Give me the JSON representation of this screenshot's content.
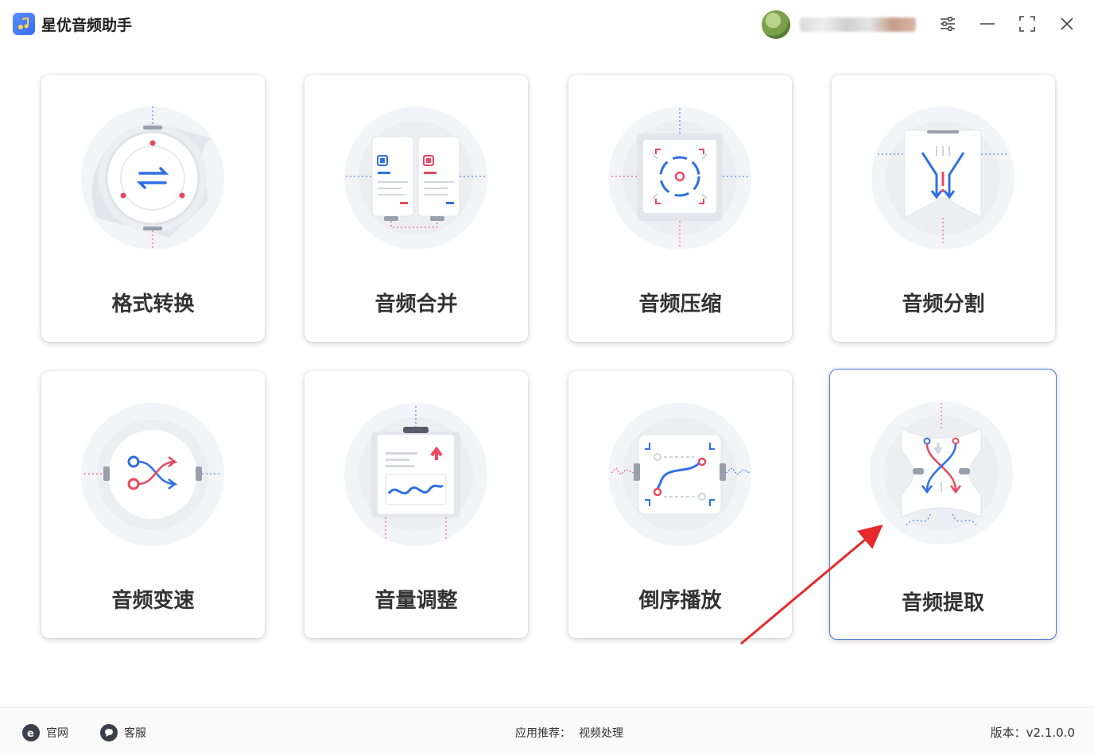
{
  "app": {
    "title": "星优音频助手"
  },
  "cards": [
    {
      "label": "格式转换"
    },
    {
      "label": "音频合并"
    },
    {
      "label": "音频压缩"
    },
    {
      "label": "音频分割"
    },
    {
      "label": "音频变速"
    },
    {
      "label": "音量调整"
    },
    {
      "label": "倒序播放"
    },
    {
      "label": "音频提取"
    }
  ],
  "footer": {
    "website": "官网",
    "support": "客服",
    "recommend_label": "应用推荐：",
    "recommend_link": "视频处理",
    "version": "版本：v2.1.0.0"
  },
  "colors": {
    "accent_blue": "#2f6fe4",
    "accent_red": "#e8495f",
    "card_border_active": "#4a7de0"
  },
  "icons": [
    "settings-icon",
    "minimize-icon",
    "maximize-icon",
    "close-icon",
    "ie-icon",
    "chat-icon"
  ]
}
